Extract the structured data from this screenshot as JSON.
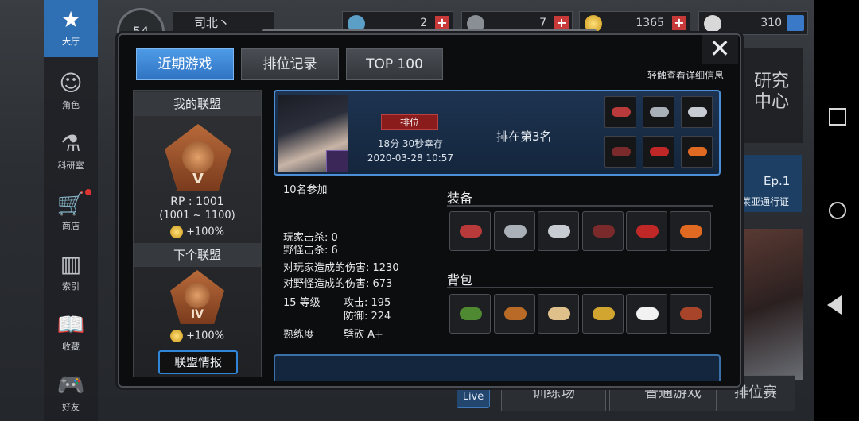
{
  "nav": [
    {
      "label": "大厅",
      "icon": "star-logo-icon"
    },
    {
      "label": "角色",
      "icon": "character-icon"
    },
    {
      "label": "科研室",
      "icon": "flask-icon"
    },
    {
      "label": "商店",
      "icon": "cart-icon"
    },
    {
      "label": "索引",
      "icon": "index-icon"
    },
    {
      "label": "收藏",
      "icon": "book-icon"
    },
    {
      "label": "好友",
      "icon": "gamepad-icon"
    }
  ],
  "topbar": {
    "level": "54",
    "username": "司北丶",
    "res1": "2",
    "res2": "7",
    "coins": "1365",
    "bp_value": "310"
  },
  "background": {
    "research": "研究\n中心",
    "ep_title": "Ep.1",
    "ep_sub": "莱亚通行证",
    "btn_train": "训练场",
    "btn_normal": "普通游戏",
    "btn_ranked": "排位赛",
    "live": "Live"
  },
  "modal": {
    "tabs": [
      "近期游戏",
      "排位记录",
      "TOP 100"
    ],
    "hint": "轻触查看详细信息",
    "close": "✕"
  },
  "league": {
    "my_title": "我的联盟",
    "my_rank_numeral": "V",
    "rp": "RP : 1001",
    "rp_range": "(1001 ~ 1100)",
    "bonus": "+100%",
    "next_title": "下个联盟",
    "next_rank_numeral": "IV",
    "next_bonus": "+100%",
    "info_button": "联盟情报"
  },
  "match": {
    "tag": "排位",
    "survival": "18分 30秒幸存",
    "datetime": "2020-03-28 10:57",
    "placement": "排在第3名",
    "participants": "10名参加",
    "stats": {
      "player_kills": "玩家击杀: 0",
      "monster_kills": "野怪击杀: 6",
      "player_damage": "对玩家造成的伤害: 1230",
      "monster_damage": "对野怪造成的伤害: 673",
      "level": "15 等级",
      "attack": "攻击: 195",
      "defense": "防御: 224",
      "mastery_label": "熟练度",
      "mastery_value": "劈砍 A+"
    },
    "equip_title": "装备",
    "bag_title": "背包"
  },
  "colors": {
    "accent": "#2f73c2",
    "rank_red": "#8a1c1c",
    "gold": "#e2a32a"
  }
}
